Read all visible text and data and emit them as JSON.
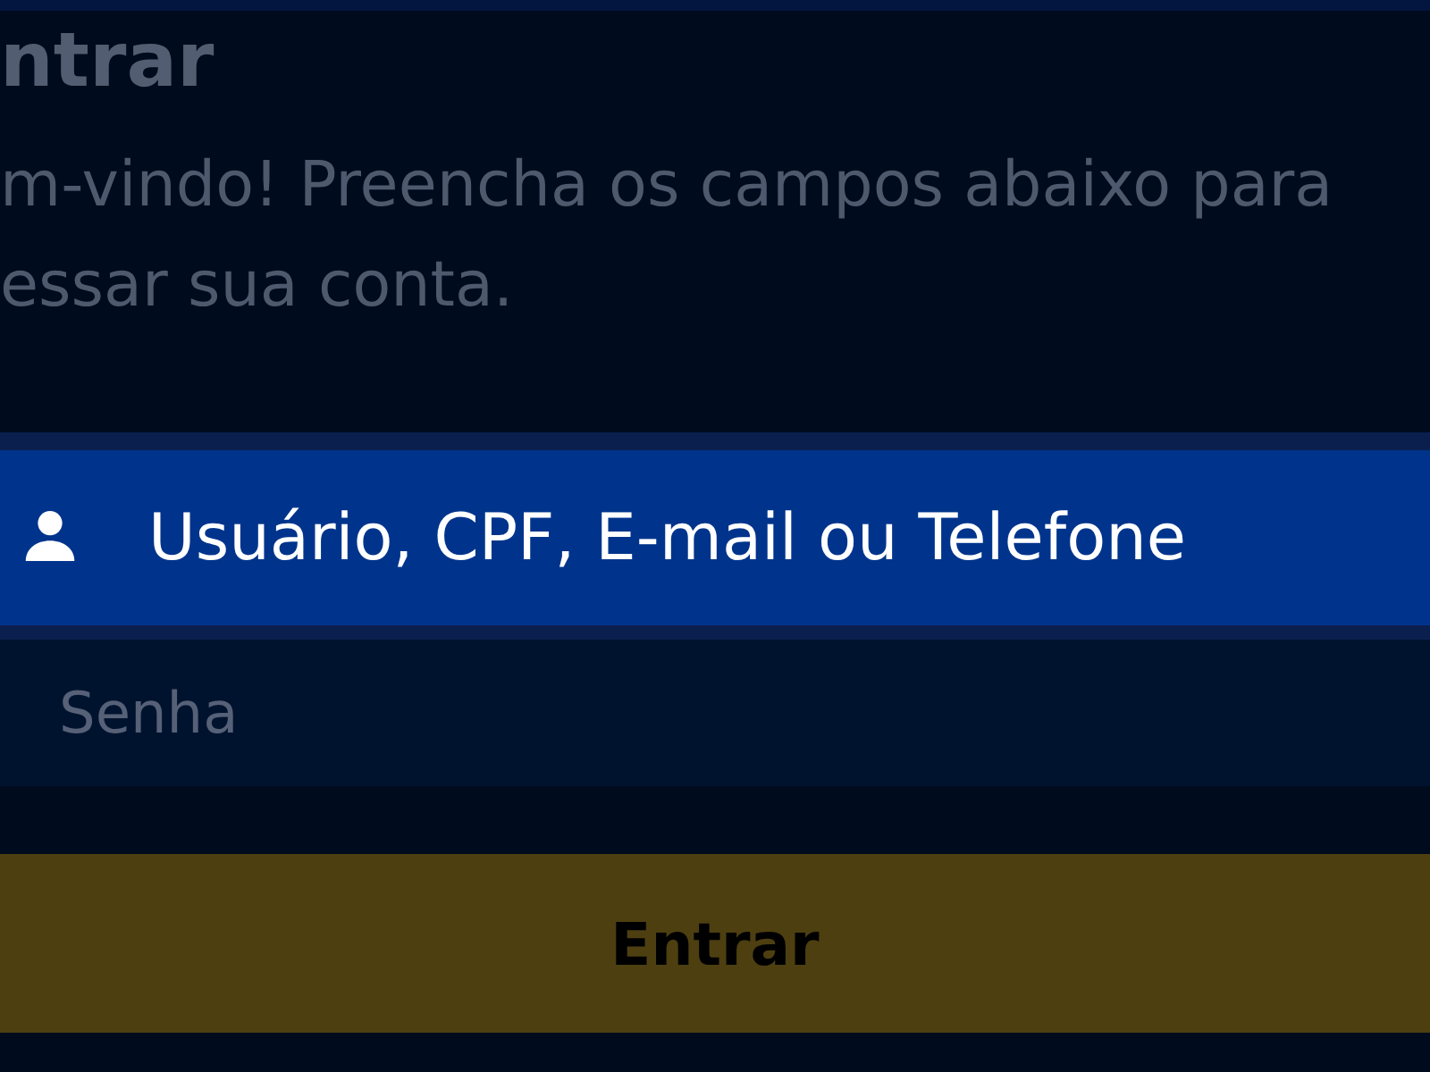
{
  "heading": "ntrar",
  "intro": {
    "lines": [
      "m-vindo! Preencha os campos abaixo para",
      "essar sua conta."
    ]
  },
  "fields": [
    {
      "kind": "user",
      "placeholder": "Usuário, CPF, E-mail ou Telefone",
      "highlighted": true
    },
    {
      "kind": "password",
      "placeholder": "Senha",
      "highlighted": false
    }
  ],
  "submit_button": {
    "label": "Entrar"
  }
}
